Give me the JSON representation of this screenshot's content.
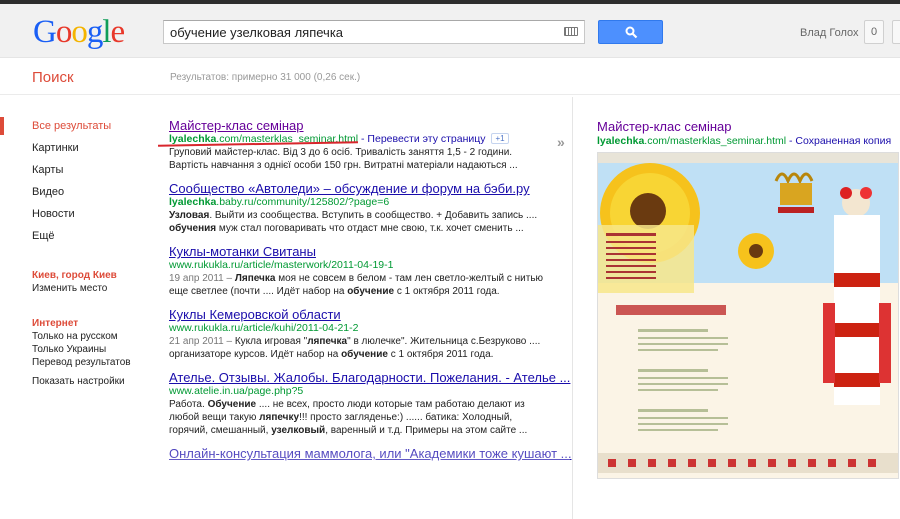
{
  "logo": "Google",
  "search": {
    "query": "обучение узелковая ляпечка"
  },
  "user": {
    "name": "Влад Голох",
    "count": "0"
  },
  "subbar": {
    "title": "Поиск",
    "stats": "Результатов: примерно 31 000 (0,26 сек.)"
  },
  "nav": {
    "items": [
      "Все результаты",
      "Картинки",
      "Карты",
      "Видео",
      "Новости",
      "Ещё"
    ],
    "location_title": "Киев, город Киев",
    "location_change": "Изменить место",
    "filter_title": "Интернет",
    "filters": [
      "Только на русском",
      "Только Украины",
      "Перевод результатов"
    ],
    "settings": "Показать настройки"
  },
  "results": [
    {
      "title": "Майстер-клас семінар",
      "url_bold": "lyalechka",
      "url_rest": ".com/masterklas_seminar.html",
      "translate": "- Перевести эту страницу",
      "plus": "+1",
      "snippet": "Груповий майстер-клас. Від 3 до 6 осіб. Тривалість заняття 1,5 - 2 години. Вартість навчання з однієї особи 150 грн. Витратні матеріали надаються ..."
    },
    {
      "title": "Сообщество «Автоледи» – обсуждение и форум на бэби.ру",
      "url_bold": "lyalechka",
      "url_rest": ".baby.ru/community/125802/?page=6",
      "snippet_b1": "Узловая",
      "snippet_1": ". Выйти из сообщества. Вступить в сообщество. + Добавить запись .... ",
      "snippet_b2": "обучения",
      "snippet_2": " муж стал поговаривать что отдаст мне свою, т.к. хочет сменить ..."
    },
    {
      "title": "Куклы-мотанки Свитаны",
      "url": "www.rukukla.ru/article/masterwork/2011-04-19-1",
      "date": "19 апр 2011 –",
      "snippet_b1": "Ляпечка",
      "snippet_1": " моя не совсем в белом - там лен светло-желтый с нитью еще светлее (почти .... Идёт набор на ",
      "snippet_b2": "обучение",
      "snippet_2": " с 1 октября 2011 года."
    },
    {
      "title": "Куклы Кемеровской области",
      "url": "www.rukukla.ru/article/kuhi/2011-04-21-2",
      "date": "21 апр 2011 –",
      "snippet_1": " Кукла игровая \"",
      "snippet_b1": "ляпечка",
      "snippet_2": "\" в люлечке\". Жительница с.Безруково .... организаторе курсов. Идёт набор на ",
      "snippet_b2": "обучение",
      "snippet_3": " с 1 октября 2011 года."
    },
    {
      "title": "Ателье. Отзывы. Жалобы. Благодарности. Пожелания. - Ателье ...",
      "url": "www.atelie.in.ua/page.php?5",
      "snippet_1": "Работа. ",
      "snippet_b1": "Обучение",
      "snippet_2": " .... не всех, просто люди которые там работаю делают из любой вещи такую ",
      "snippet_b2": "ляпечку",
      "snippet_3": "!!! просто загляденье:) ...... батика: Холодный, горячий, смешанный, ",
      "snippet_b3": "узелковый",
      "snippet_4": ", варенный и т.д. Примеры на этом сайте ..."
    },
    {
      "title": "Онлайн-консультация маммолога, или \"Академики тоже кушают ..."
    }
  ],
  "preview": {
    "title": "Майстер-клас семінар",
    "url_bold": "lyalechka",
    "url_rest": ".com/masterklas_seminar.html",
    "cached": "- Сохраненная копия"
  },
  "colors": {
    "accent_red": "#dd4b39",
    "link_blue": "#1a0dab",
    "url_green": "#093",
    "visited": "#609",
    "search_blue": "#4d90fe"
  }
}
